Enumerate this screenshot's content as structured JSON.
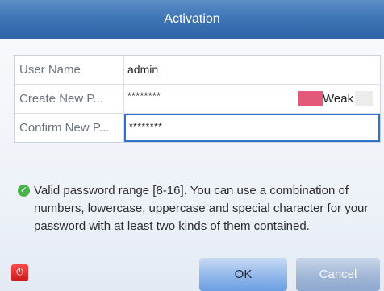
{
  "window": {
    "title": "Activation"
  },
  "form": {
    "username_label": "User Name",
    "username_value": "admin",
    "new_password_label": "Create New P...",
    "new_password_value": "********",
    "strength_label": "Weak",
    "confirm_password_label": "Confirm New P...",
    "confirm_password_value": "********"
  },
  "hint": {
    "text": "Valid password range [8-16]. You can use a combination of numbers, lowercase, uppercase and special character for your password with at least two kinds of them contained."
  },
  "buttons": {
    "ok": "OK",
    "cancel": "Cancel"
  },
  "icons": {
    "check": "check-circle-icon",
    "bottom": "power-icon"
  },
  "colors": {
    "accent": "#2f74c8",
    "weak": "#e4587a",
    "ok_gradient": "#8db4ea",
    "cancel_gradient": "#9fb5d6"
  }
}
